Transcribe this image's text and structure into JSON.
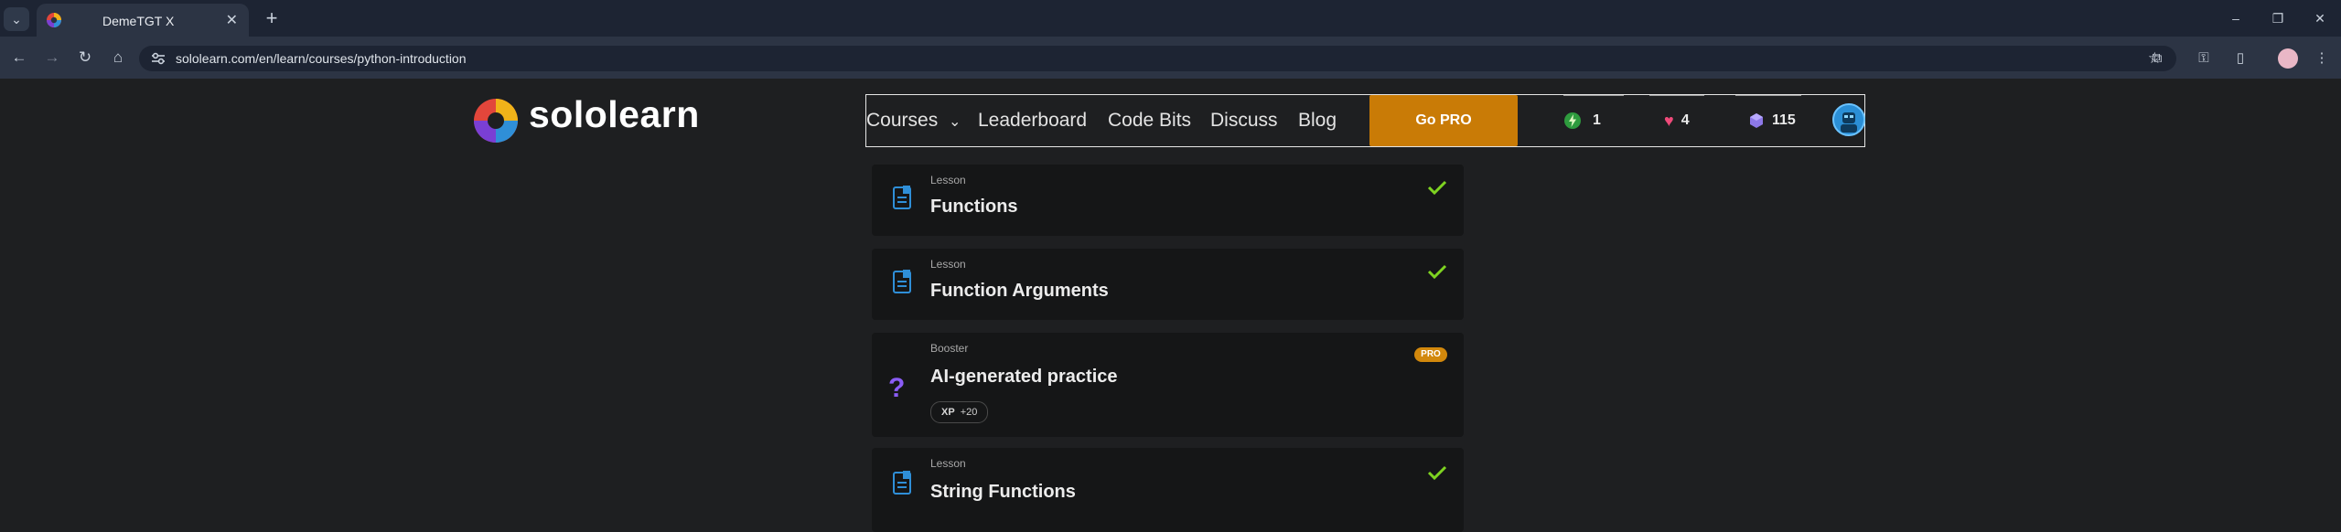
{
  "browser": {
    "tab_title": "DemeTGT X",
    "url": "sololearn.com/en/learn/courses/python-introduction",
    "new_tab_label": "+",
    "window_minimize": "–",
    "window_restore": "❐",
    "window_close": "✕"
  },
  "brand": {
    "name": "sololearn"
  },
  "nav": {
    "courses": "Courses",
    "leaderboard": "Leaderboard",
    "code_bits": "Code Bits",
    "discuss": "Discuss",
    "blog": "Blog",
    "go_pro": "Go PRO"
  },
  "stats": {
    "streak": "1",
    "hearts": "4",
    "gems": "115"
  },
  "lessons": [
    {
      "kind": "Lesson",
      "title": "Functions",
      "completed": true
    },
    {
      "kind": "Lesson",
      "title": "Function Arguments",
      "completed": true
    },
    {
      "kind": "Booster",
      "title": "AI-generated practice",
      "badge": "PRO",
      "xp_label": "XP",
      "xp_value": "+20"
    },
    {
      "kind": "Lesson",
      "title": "String Functions",
      "completed": true
    }
  ],
  "colors": {
    "accent_orange": "#c97b06",
    "check_green": "#7ed321",
    "lesson_icon_blue": "#2f8fd8",
    "booster_purple": "#8a5cf5"
  }
}
